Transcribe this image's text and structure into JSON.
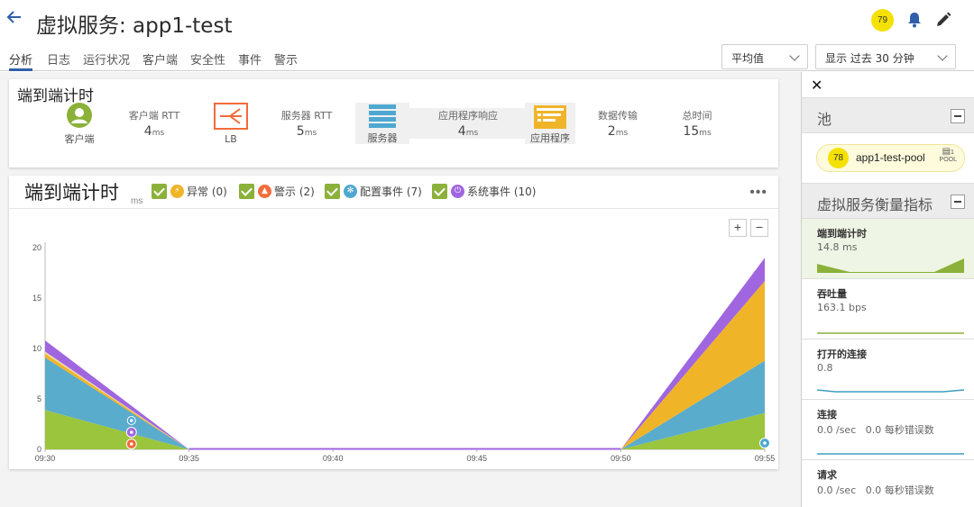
{
  "header": {
    "title": "虚拟服务: app1-test",
    "badge": "79"
  },
  "tabs": [
    {
      "label": "分析",
      "active": true
    },
    {
      "label": "日志"
    },
    {
      "label": "运行状况"
    },
    {
      "label": "客户端"
    },
    {
      "label": "安全性"
    },
    {
      "label": "事件"
    },
    {
      "label": "警示"
    }
  ],
  "controls": {
    "aggregate": "平均值",
    "timerange": "显示 过去 30 分钟"
  },
  "e2e": {
    "title": "端到端计时",
    "client_label": "客户端",
    "client_rtt_name": "客户端 RTT",
    "client_rtt_val": "4",
    "lb_label": "LB",
    "server_rtt_name": "服务器 RTT",
    "server_rtt_val": "5",
    "server_label": "服务器",
    "app_resp_name": "应用程序响应",
    "app_resp_val": "4",
    "app_label": "应用程序",
    "data_xfer_name": "数据传输",
    "data_xfer_val": "2",
    "total_name": "总时间",
    "total_val": "15",
    "unit": "ms"
  },
  "chart_card": {
    "title": "端到端计时",
    "unit": "ms",
    "legend": [
      {
        "label": "异常 (0)",
        "color": "#f0b429",
        "icon": "lightning-icon"
      },
      {
        "label": "警示 (2)",
        "color": "#f26b3a",
        "icon": "bell-icon"
      },
      {
        "label": "配置事件 (7)",
        "color": "#4fa8d1",
        "icon": "gear-icon"
      },
      {
        "label": "系统事件 (10)",
        "color": "#a66ee0",
        "icon": "power-icon"
      }
    ],
    "zoom_in": "+",
    "zoom_out": "−",
    "more": "•••"
  },
  "chart_data": {
    "type": "area",
    "stacked": true,
    "x": [
      "09:30",
      "09:35",
      "09:50",
      "09:55"
    ],
    "xticks": [
      "09:30",
      "09:35",
      "09:40",
      "09:45",
      "09:50",
      "09:55"
    ],
    "yticks": [
      "0",
      "5",
      "10",
      "15",
      "20"
    ],
    "ylim": [
      0,
      20
    ],
    "series": [
      {
        "color": "#9bc53d",
        "values": [
          3.9,
          0,
          0,
          3.6
        ]
      },
      {
        "color": "#5aaccc",
        "values": [
          5.2,
          0,
          0,
          5.2
        ]
      },
      {
        "color": "#f0b429",
        "values": [
          0.4,
          0,
          0,
          7.9
        ]
      },
      {
        "color": "#f0d7a0",
        "values": [
          0.2,
          0,
          0,
          0
        ]
      },
      {
        "color": "#a066e0",
        "values": [
          1.1,
          0,
          0,
          2.3
        ]
      }
    ],
    "events": [
      {
        "x": "09:33",
        "type": "config",
        "icon": "gear-icon",
        "color": "#4fa8d1"
      },
      {
        "x": "09:33",
        "type": "system",
        "icon": "power-icon",
        "color": "#a066e0"
      },
      {
        "x": "09:33",
        "type": "alert",
        "icon": "bell-icon",
        "color": "#f26b3a"
      },
      {
        "x": "09:55",
        "type": "config",
        "icon": "gear-icon",
        "color": "#4fa8d1"
      }
    ]
  },
  "right_panel": {
    "pool_section": "池",
    "pool": {
      "badge": "78",
      "name": "app1-test-pool",
      "count": "1",
      "kind": "POOL"
    },
    "metrics_section": "虚拟服务衡量指标",
    "metrics": [
      {
        "title": "端到端计时",
        "value": "14.8 ms",
        "active": true,
        "color": "#8bb13a"
      },
      {
        "title": "吞吐量",
        "value": "163.1 bps",
        "color": "#8bb13a"
      },
      {
        "title": "打开的连接",
        "value": "0.8",
        "color": "#3d9fbf"
      },
      {
        "title": "连接",
        "value": "0.0 /sec   0.0 每秒错误数",
        "color": "#3d9fbf"
      },
      {
        "title": "请求",
        "value": "0.0 /sec   0.0 每秒错误数",
        "color": "#3d9fbf"
      }
    ]
  }
}
